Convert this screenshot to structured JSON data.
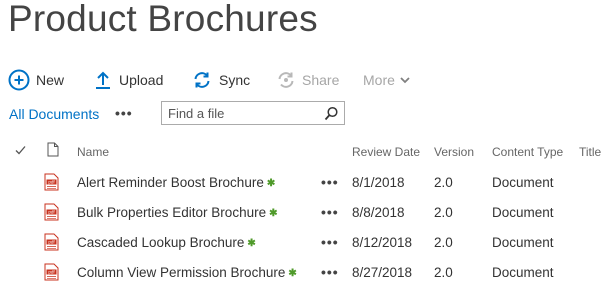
{
  "page": {
    "title": "Product Brochures"
  },
  "toolbar": {
    "new_label": "New",
    "upload_label": "Upload",
    "sync_label": "Sync",
    "share_label": "Share",
    "more_label": "More"
  },
  "views": {
    "current_label": "All Documents",
    "more_glyph": "•••"
  },
  "search": {
    "placeholder": "Find a file",
    "value": ""
  },
  "columns": {
    "name": "Name",
    "review_date": "Review Date",
    "version": "Version",
    "content_type": "Content Type",
    "title": "Title"
  },
  "rows": [
    {
      "name": "Alert Reminder Boost Brochure",
      "review_date": "8/1/2018",
      "version": "2.0",
      "content_type": "Document",
      "new_marker": "✱",
      "dots": "•••"
    },
    {
      "name": "Bulk Properties Editor Brochure",
      "review_date": "8/8/2018",
      "version": "2.0",
      "content_type": "Document",
      "new_marker": "✱",
      "dots": "•••"
    },
    {
      "name": "Cascaded Lookup Brochure",
      "review_date": "8/12/2018",
      "version": "2.0",
      "content_type": "Document",
      "new_marker": "✱",
      "dots": "•••"
    },
    {
      "name": "Column View Permission Brochure",
      "review_date": "8/27/2018",
      "version": "2.0",
      "content_type": "Document",
      "new_marker": "✱",
      "dots": "•••"
    }
  ],
  "colors": {
    "accent": "#0072c6",
    "new_marker": "#4f9a2a",
    "pdf": "#c8321e"
  },
  "icons": {
    "new": "plus-circle-icon",
    "upload": "upload-arrow-icon",
    "sync": "sync-icon",
    "share": "share-icon",
    "more": "chevron-down-icon",
    "search": "magnifier-icon",
    "select_all": "checkmark-icon",
    "file_type": "document-icon",
    "pdf": "pdf-file-icon"
  }
}
